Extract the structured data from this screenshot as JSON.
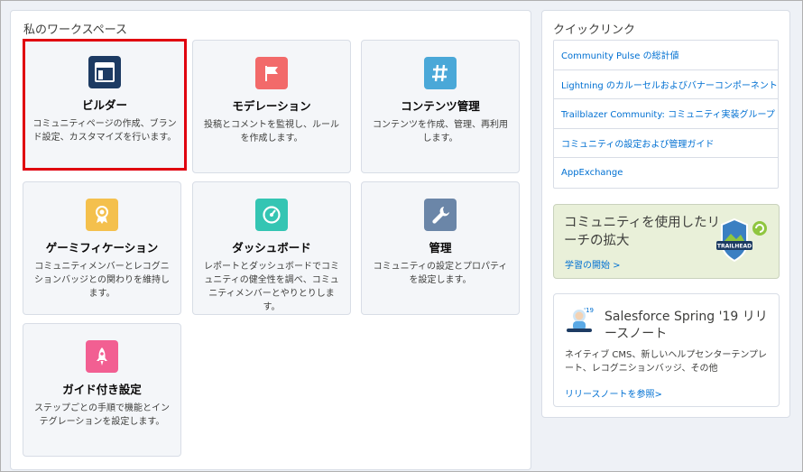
{
  "workspace": {
    "title": "私のワークスペース",
    "tiles": [
      {
        "title": "ビルダー",
        "desc": "コミュニティページの作成、ブランド設定、カスタマイズを行います。",
        "color": "#1d3b63",
        "icon": "builder-icon"
      },
      {
        "title": "モデレーション",
        "desc": "投稿とコメントを監視し、ルールを作成します。",
        "color": "#f26a6a",
        "icon": "flag-icon"
      },
      {
        "title": "コンテンツ管理",
        "desc": "コンテンツを作成、管理、再利用します。",
        "color": "#4aa8d8",
        "icon": "hashtag-icon"
      },
      {
        "title": "ゲーミフィケーション",
        "desc": "コミュニティメンバーとレコグニションバッジとの関わりを維持します。",
        "color": "#f4c04d",
        "icon": "award-icon"
      },
      {
        "title": "ダッシュボード",
        "desc": "レポートとダッシュボードでコミュニティの健全性を調べ、コミュニティメンバーとやりとりします。",
        "color": "#34c5b3",
        "icon": "gauge-icon"
      },
      {
        "title": "管理",
        "desc": "コミュニティの設定とプロパティを設定します。",
        "color": "#6b86a8",
        "icon": "wrench-icon"
      },
      {
        "title": "ガイド付き設定",
        "desc": "ステップごとの手順で機能とインテグレーションを設定します。",
        "color": "#f25f92",
        "icon": "rocket-icon"
      }
    ]
  },
  "quick_links": {
    "title": "クイックリンク",
    "items": [
      "Community Pulse の総計値",
      "Lightning のカルーセルおよびバナーコンポーネント",
      "Trailblazer Community: コミュニティ実装グループ",
      "コミュニティの設定および管理ガイド",
      "AppExchange"
    ]
  },
  "trailhead": {
    "text": "コミュニティを使用したリーチの拡大",
    "link": "学習の開始 >",
    "badge": "TRAILHEAD"
  },
  "release": {
    "title": "Salesforce Spring '19 リリースノート",
    "badge": "'19",
    "desc": "ネイティブ CMS、新しいヘルプセンターテンプレート、レコグニションバッジ、その他",
    "link": "リリースノートを参照>"
  }
}
